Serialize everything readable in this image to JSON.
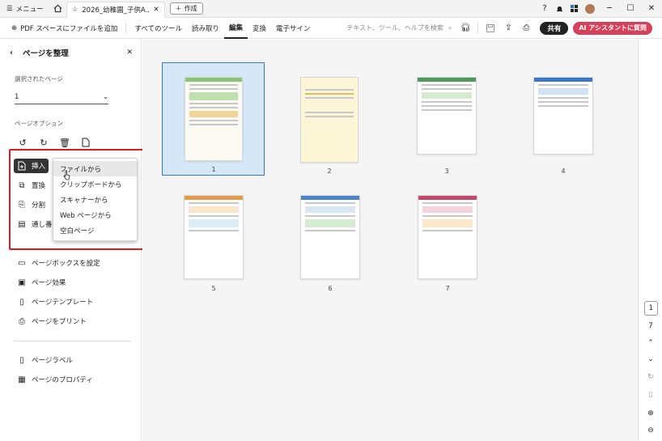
{
  "titlebar": {
    "menu_label": "メニュー",
    "tab_title": "2026_幼稚園_子供A...",
    "new_label": "作成"
  },
  "toolbar": {
    "add_label": "PDF スペースにファイルを追加",
    "items": [
      "すべてのツール",
      "読み取り",
      "編集",
      "変換",
      "電子サイン"
    ],
    "active_item": "編集",
    "search_placeholder": "テキスト、ツール、ヘルプを検索",
    "share_label": "共有",
    "ai_label": "AI アシスタントに質問"
  },
  "panel": {
    "title": "ページを整理",
    "selected_page_label": "選択されたページ",
    "selected_page_value": "1",
    "options_label": "ページオプション",
    "insert_label": "挿入",
    "replace_label": "置換",
    "split_label": "分割",
    "number_label": "通し番号",
    "actions": [
      "ページボックスを設定",
      "ページ効果",
      "ページテンプレート",
      "ページをプリント"
    ],
    "footer_actions": [
      "ページラベル",
      "ページのプロパティ"
    ]
  },
  "insert_menu": {
    "items": [
      "ファイルから",
      "クリップボードから",
      "スキャナーから",
      "Web ページから",
      "空白ページ"
    ],
    "hovered": "ファイルから"
  },
  "thumbnails": [
    {
      "number": "1",
      "accent": "#7fb36a",
      "selected": true
    },
    {
      "number": "2",
      "accent": "#e8d9a0",
      "selected": false
    },
    {
      "number": "3",
      "accent": "#4e9a5b",
      "selected": false
    },
    {
      "number": "4",
      "accent": "#3a78c4",
      "selected": false
    },
    {
      "number": "5",
      "accent": "#e49a4a",
      "selected": false
    },
    {
      "number": "6",
      "accent": "#4d84c8",
      "selected": false
    },
    {
      "number": "7",
      "accent": "#c04a6a",
      "selected": false
    }
  ],
  "rail": {
    "current_page": "1",
    "total_pages": "7"
  },
  "colors": {
    "accent_red": "#e01b24",
    "ai_button": "#d7405a",
    "selection_blue": "#2e7bd0"
  }
}
